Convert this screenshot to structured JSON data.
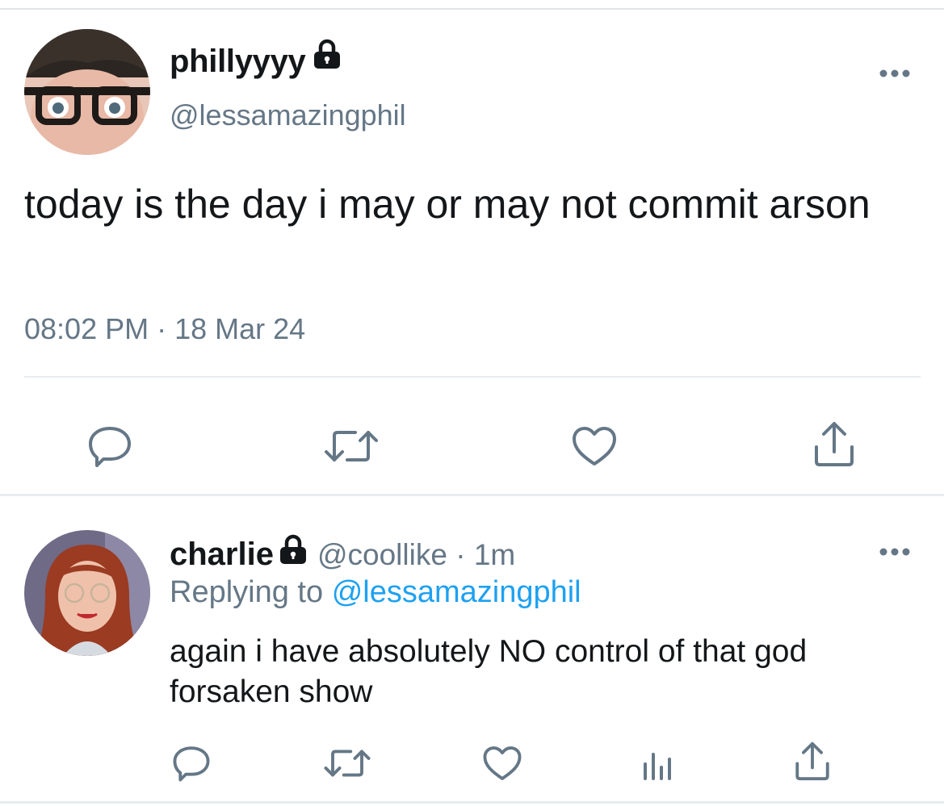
{
  "main_tweet": {
    "display_name": "phillyyyy",
    "handle": "@lessamazingphil",
    "text": "today is the day i may or may not commit arson",
    "timestamp": "08:02 PM · 18 Mar 24",
    "avatar": "avatar-photo-man-with-glasses",
    "icons": [
      "lock-icon",
      "more-icon",
      "reply-icon",
      "retweet-icon",
      "like-icon",
      "share-icon"
    ]
  },
  "reply_tweet": {
    "display_name": "charlie",
    "handle": "@coollike",
    "separator": "·",
    "time_ago": "1m",
    "replying_prefix": "Replying to",
    "replying_to": "@lessamazingphil",
    "text": "again i have absolutely NO control of that god forsaken show",
    "avatar": "avatar-photo-woman-with-red-hair",
    "icons": [
      "lock-icon",
      "more-icon",
      "reply-icon",
      "retweet-icon",
      "like-icon",
      "analytics-icon",
      "share-icon"
    ]
  },
  "colors": {
    "text_primary": "#14171a",
    "text_secondary": "#657786",
    "link": "#1da1f2",
    "divider": "#e6ecf0"
  }
}
